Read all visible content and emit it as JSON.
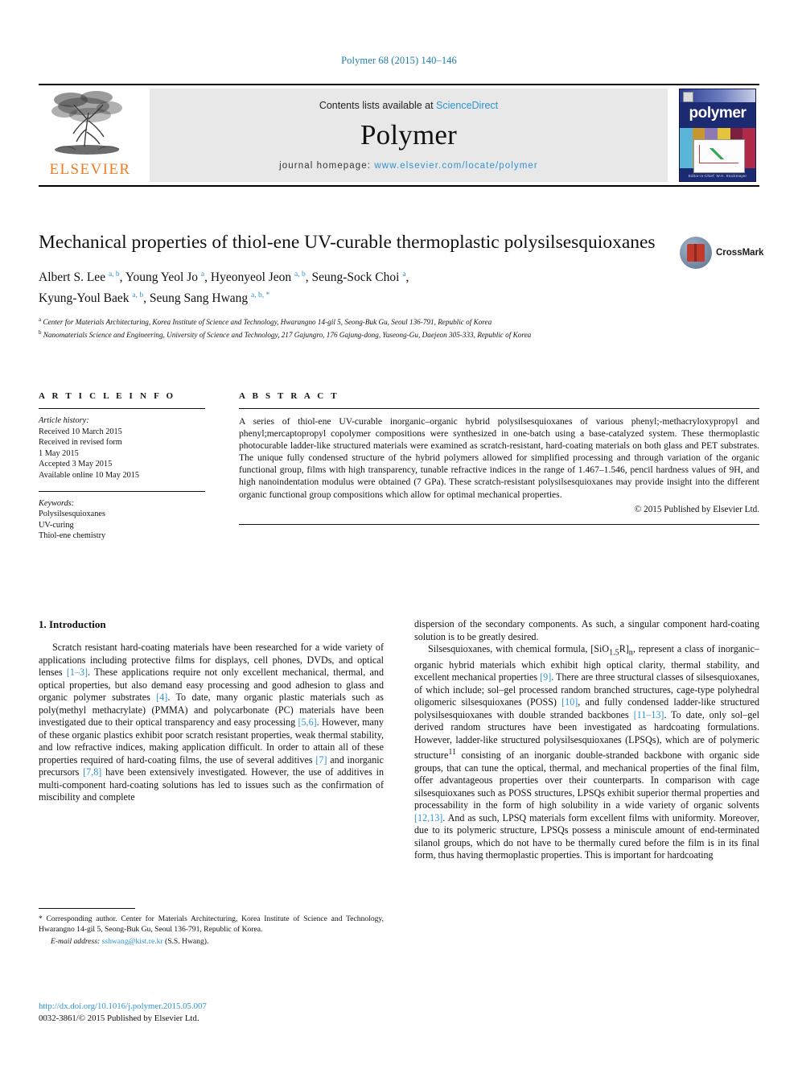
{
  "running_head": "Polymer 68 (2015) 140–146",
  "masthead": {
    "publisher_name": "ELSEVIER",
    "contents_prefix": "Contents lists available at ",
    "contents_link": "ScienceDirect",
    "journal_title": "Polymer",
    "homepage_prefix": "journal homepage: ",
    "homepage_url": "www.elsevier.com/locate/polymer",
    "cover_word": "polymer",
    "cover_footer": "Editor-in-Chief: W.H. Stockmayer"
  },
  "crossmark": {
    "label": "CrossMark"
  },
  "article": {
    "title": "Mechanical properties of thiol-ene UV-curable thermoplastic polysilsesquioxanes",
    "authors": "Albert S. Lee a, b, Young Yeol Jo a, Hyeonyeol Jeon a, b, Seung-Sock Choi a, Kyung-Youl Baek a, b, Seung Sang Hwang a, b, *",
    "affiliation_a": "Center for Materials Architecturing, Korea Institute of Science and Technology, Hwarangno 14-gil 5, Seong-Buk Gu, Seoul 136-791, Republic of Korea",
    "affiliation_b": "Nanomaterials Science and Engineering, University of Science and Technology, 217 Gajungro, 176 Gajung-dong, Yuseong-Gu, Daejeon 305-333, Republic of Korea"
  },
  "article_info": {
    "heading": "A R T I C L E   I N F O",
    "history_label": "Article history:",
    "history": [
      "Received 10 March 2015",
      "Received in revised form",
      "1 May 2015",
      "Accepted 3 May 2015",
      "Available online 10 May 2015"
    ],
    "keywords_label": "Keywords:",
    "keywords": [
      "Polysilsesquioxanes",
      "UV-curing",
      "Thiol-ene chemistry"
    ]
  },
  "abstract": {
    "heading": "A B S T R A C T",
    "text": "A series of thiol-ene UV-curable inorganic–organic hybrid polysilsesquioxanes of various phenyl;-methacryloxypropyl and phenyl;mercaptopropyl copolymer compositions were synthesized in one-batch using a base-catalyzed system. These thermoplastic photocurable ladder-like structured materials were examined as scratch-resistant, hard-coating materials on both glass and PET substrates. The unique fully condensed structure of the hybrid polymers allowed for simplified processing and through variation of the organic functional group, films with high transparency, tunable refractive indices in the range of 1.467–1.546, pencil hardness values of 9H, and high nanoindentation modulus were obtained (7 GPa). These scratch-resistant polysilsesquioxanes may provide insight into the different organic functional group compositions which allow for optimal mechanical properties.",
    "copyright": "© 2015 Published by Elsevier Ltd."
  },
  "body": {
    "section_title": "1.  Introduction",
    "left_paragraphs": [
      "Scratch resistant hard-coating materials have been researched for a wide variety of applications including protective films for displays, cell phones, DVDs, and optical lenses [1–3]. These applications require not only excellent mechanical, thermal, and optical properties, but also demand easy processing and good adhesion to glass and organic polymer substrates [4]. To date, many organic plastic materials such as poly(methyl methacrylate) (PMMA) and polycarbonate (PC) materials have been investigated due to their optical transparency and easy processing [5,6]. However, many of these organic plastics exhibit poor scratch resistant properties, weak thermal stability, and low refractive indices, making application difficult. In order to attain all of these properties required of hard-coating films, the use of several additives [7] and inorganic precursors [7,8] have been extensively investigated. However, the use of additives in multi-component hard-coating solutions has led to issues such as the confirmation of miscibility and complete"
    ],
    "right_paragraphs": [
      "dispersion of the secondary components. As such, a singular component hard-coating solution is to be greatly desired.",
      "Silsesquioxanes, with chemical formula, [SiO1.5R]n, represent a class of inorganic–organic hybrid materials which exhibit high optical clarity, thermal stability, and excellent mechanical properties [9]. There are three structural classes of silsesquioxanes, of which include; sol–gel processed random branched structures, cage-type polyhedral oligomeric silsesquioxanes (POSS) [10], and fully condensed ladder-like structured polysilsesquioxanes with double stranded backbones [11–13]. To date, only sol–gel derived random structures have been investigated as hardcoating formulations. However, ladder-like structured polysilsesquioxanes (LPSQs), which are of polymeric structure 11 consisting of an inorganic double-stranded backbone with organic side groups, that can tune the optical, thermal, and mechanical properties of the final film, offer advantageous properties over their counterparts. In comparison with cage silsesquioxanes such as POSS structures, LPSQs exhibit superior thermal properties and processability in the form of high solubility in a wide variety of organic solvents [12,13]. And as such, LPSQ materials form excellent films with uniformity. Moreover, due to its polymeric structure, LPSQs possess a miniscule amount of end-terminated silanol groups, which do not have to be thermally cured before the film is in its final form, thus having thermoplastic properties. This is important for hardcoating"
    ]
  },
  "footnote": {
    "corresponding": "* Corresponding author. Center for Materials Architecturing, Korea Institute of Science and Technology, Hwarangno 14-gil 5, Seong-Buk Gu, Seoul 136-791, Republic of Korea.",
    "email_label": "E-mail address:",
    "email": "sshwang@kist.re.kr",
    "email_suffix": "(S.S. Hwang)."
  },
  "imprint": {
    "doi": "http://dx.doi.org/10.1016/j.polymer.2015.05.007",
    "issn_line": "0032-3861/© 2015 Published by Elsevier Ltd."
  }
}
